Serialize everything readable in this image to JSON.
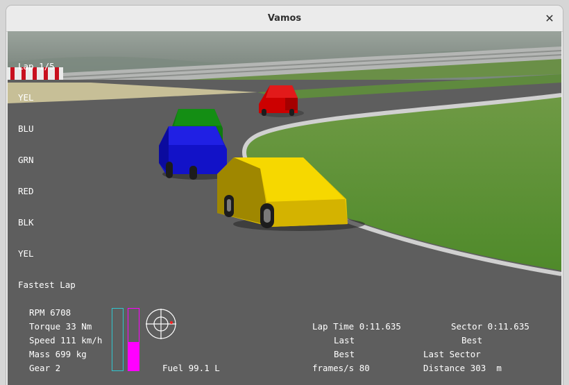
{
  "window": {
    "title": "Vamos"
  },
  "race": {
    "lap": "Lap 1/5",
    "standings": [
      "YEL",
      "BLU",
      "GRN",
      "RED",
      "BLK",
      "YEL"
    ],
    "fastest_lap": "Fastest Lap"
  },
  "telemetry": {
    "rpm": "RPM 6708",
    "torque": "Torque 33 Nm",
    "speed": "Speed 111 km/h",
    "mass": "Mass 699 kg",
    "gear": "Gear 2",
    "fuel": "Fuel 99.1 L"
  },
  "gauges": {
    "throttle_fraction": 0.0,
    "brake_fraction": 0.46,
    "throttle_color": "#2fc7d0",
    "brake_color": "#ff00ff"
  },
  "timing": {
    "lap_time": "Lap Time 0:11.635",
    "last": "Last",
    "best": "Best",
    "fps": "frames/s 80",
    "sector": "Sector 0:11.635",
    "sector_best": "Best",
    "last_sector": "Last Sector",
    "distance": "Distance 303  m"
  },
  "cars": [
    {
      "name": "yellow-car",
      "color": "#f2d200"
    },
    {
      "name": "blue-car",
      "color": "#1212c8"
    },
    {
      "name": "green-car",
      "color": "#0f7a0f"
    },
    {
      "name": "red-car",
      "color": "#cc0000"
    }
  ]
}
